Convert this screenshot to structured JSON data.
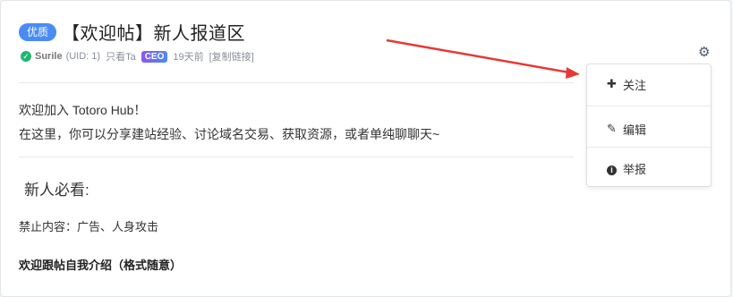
{
  "post": {
    "badge": "优质",
    "title": "【欢迎帖】新人报道区",
    "author": "Surile",
    "uid": "(UID: 1)",
    "follow_hint": "只看Ta",
    "role": "CEO",
    "time": "19天前",
    "copy_link": "[复制链接]"
  },
  "content": {
    "line1": "欢迎加入 Totoro Hub！",
    "line2": "在这里，你可以分享建站经验、讨论域名交易、获取资源，或者单纯聊聊天~",
    "section_title": "新人必看:",
    "forbidden": "禁止内容：广告、人身攻击",
    "intro": "欢迎跟帖自我介绍（格式随意）"
  },
  "menu": {
    "follow": "关注",
    "edit": "编辑",
    "report": "举报"
  },
  "icons": {
    "gear": "gear-icon",
    "plus": "plus-icon",
    "edit": "edit-icon",
    "info": "info-icon",
    "check": "verified-icon"
  },
  "colors": {
    "badge": "#4a8bf5",
    "verified": "#21b573",
    "arrow": "#e53935"
  }
}
